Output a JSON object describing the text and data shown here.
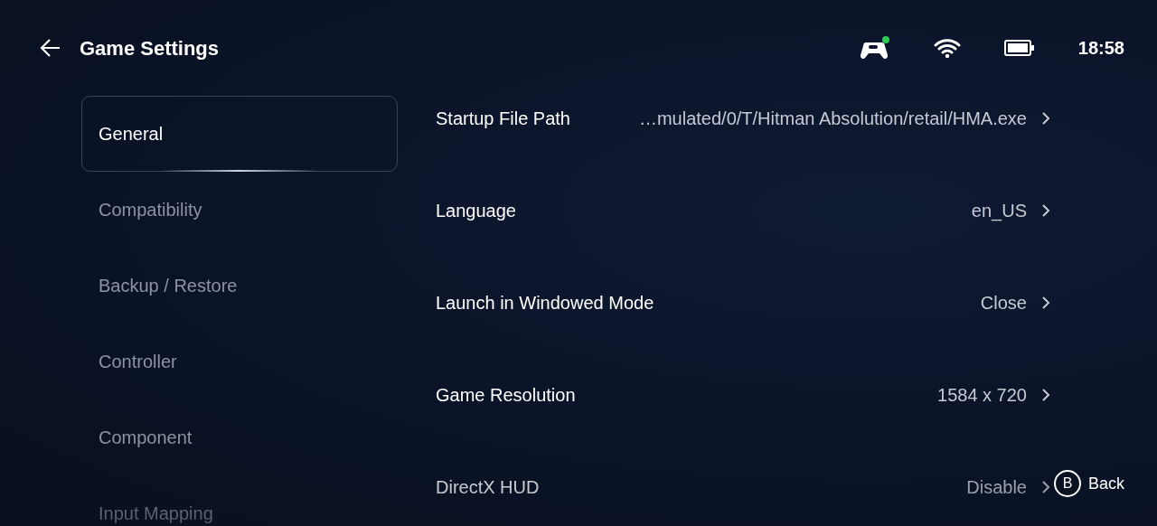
{
  "header": {
    "title": "Game Settings",
    "time": "18:58"
  },
  "sidebar": {
    "items": [
      {
        "label": "General",
        "selected": true
      },
      {
        "label": "Compatibility",
        "selected": false
      },
      {
        "label": "Backup / Restore",
        "selected": false
      },
      {
        "label": "Controller",
        "selected": false
      },
      {
        "label": "Component",
        "selected": false
      },
      {
        "label": "Input Mapping",
        "selected": false
      }
    ]
  },
  "settings": [
    {
      "label": "Startup File Path",
      "value": "…mulated/0/T/Hitman Absolution/retail/HMA.exe"
    },
    {
      "label": "Language",
      "value": "en_US"
    },
    {
      "label": "Launch in Windowed Mode",
      "value": "Close"
    },
    {
      "label": "Game Resolution",
      "value": "1584 x 720"
    },
    {
      "label": "DirectX HUD",
      "value": "Disable"
    }
  ],
  "hint": {
    "key": "B",
    "label": "Back"
  }
}
